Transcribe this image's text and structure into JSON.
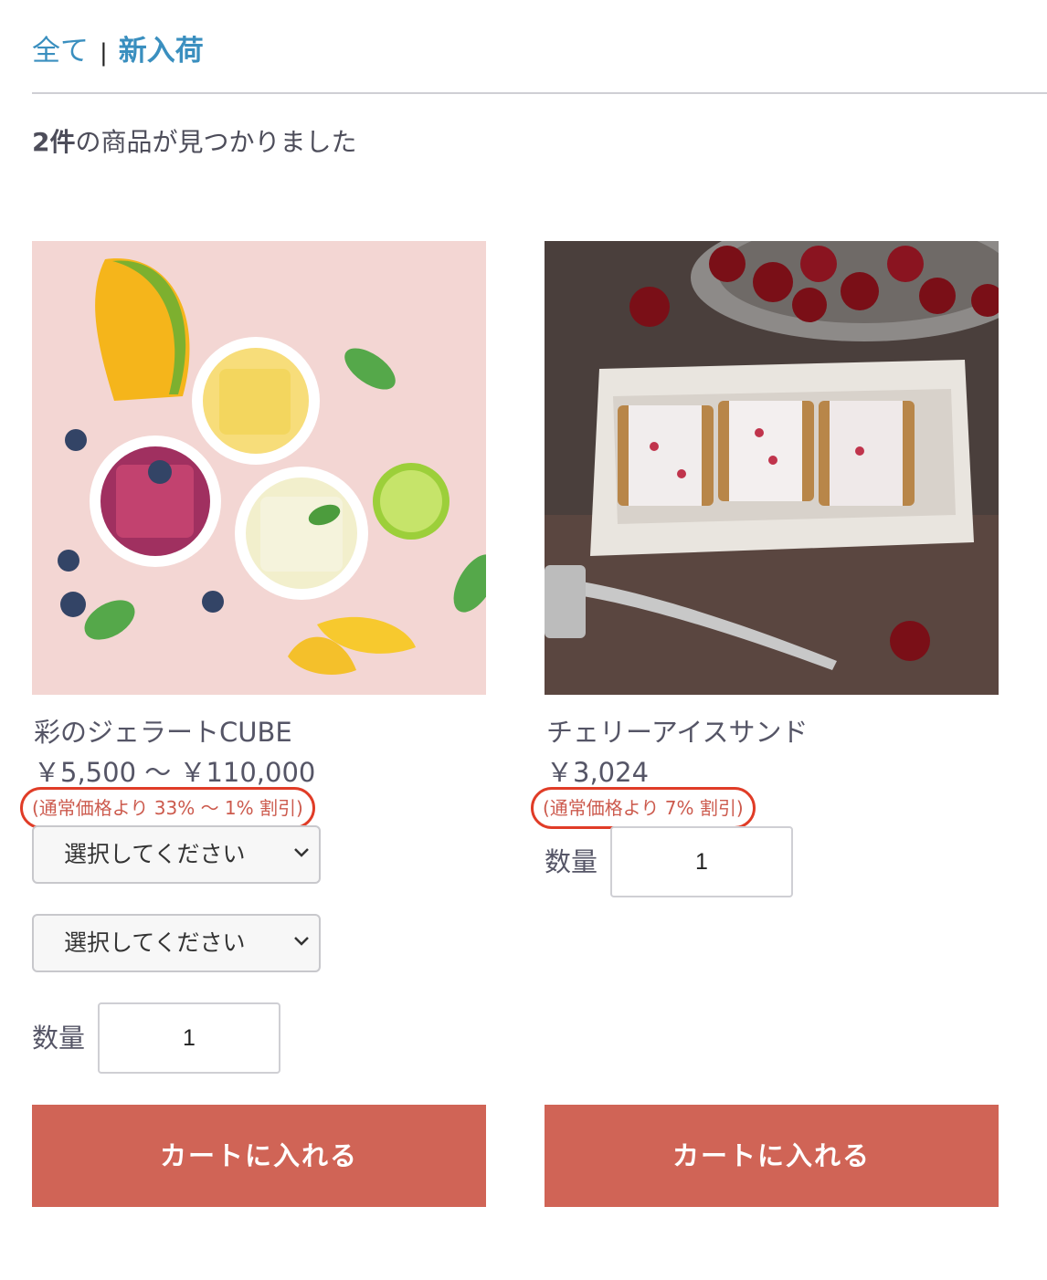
{
  "breadcrumb": {
    "all": "全て",
    "separator": "|",
    "current": "新入荷"
  },
  "result": {
    "count": "2件",
    "text": "の商品が見つかりました"
  },
  "products": [
    {
      "name": "彩のジェラートCUBE",
      "price": "￥5,500 〜 ￥110,000",
      "discount": "(通常価格より 33% 〜 1% 割引)",
      "selects": [
        "選択してください",
        "選択してください"
      ],
      "qty_label": "数量",
      "qty_value": "1",
      "cart_label": "カートに入れる"
    },
    {
      "name": "チェリーアイスサンド",
      "price": "￥3,024",
      "discount": "(通常価格より 7% 割引)",
      "qty_label": "数量",
      "qty_value": "1",
      "cart_label": "カートに入れる"
    }
  ],
  "colors": {
    "link": "#3a8fbf",
    "button": "#d06456",
    "highlight": "#e03c27"
  }
}
